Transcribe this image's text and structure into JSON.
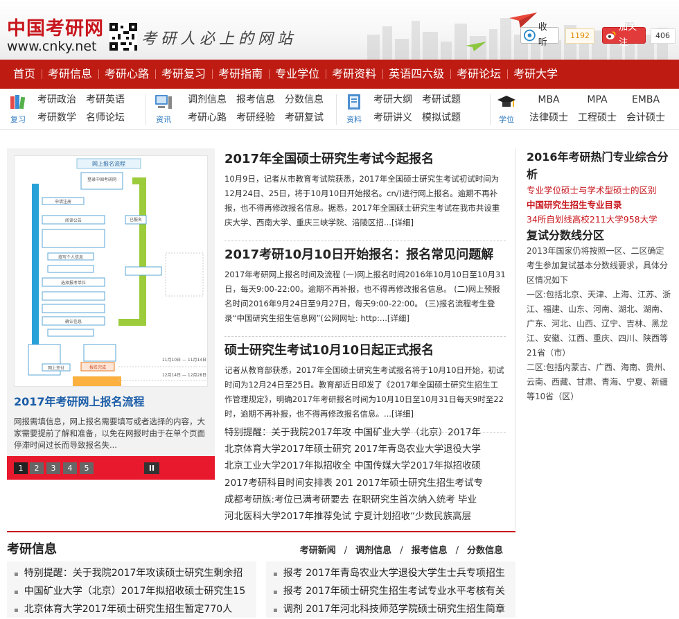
{
  "header": {
    "logo_cn": "中国考研网",
    "logo_en": "www.cnky.net",
    "slogan": "考研人必上的网站",
    "tqq": {
      "label": "收听",
      "count": "1192"
    },
    "weibo": {
      "label": "加关注",
      "count": "406"
    }
  },
  "nav": [
    "首页",
    "考研信息",
    "考研心路",
    "考研复习",
    "考研指南",
    "专业学位",
    "考研资料",
    "英语四六级",
    "考研论坛",
    "考研大学"
  ],
  "subnav": [
    {
      "icon": "books-icon",
      "label": "复习",
      "links": [
        "考研政治",
        "考研英语",
        "考研数学",
        "名师论坛"
      ]
    },
    {
      "icon": "computer-icon",
      "label": "资讯",
      "links": [
        "调剂信息",
        "报考信息",
        "分数信息",
        "考研心路",
        "考研经验",
        "考研复试"
      ]
    },
    {
      "icon": "notebook-icon",
      "label": "资料",
      "links": [
        "考研大纲",
        "考研试题",
        "考研讲义",
        "模拟试题"
      ]
    },
    {
      "icon": "graduation-cap-icon",
      "label": "学位",
      "links": [
        "MBA",
        "MPA",
        "EMBA",
        "法律硕士",
        "工程硕士",
        "会计硕士"
      ]
    }
  ],
  "slider": {
    "title": "2017年考研网上报名流程",
    "desc": "网报需填信息，网上报名需要填写或者选择的内容，大家需要提前了解和准备，以免在网报时由于在单个页面停滞时间过长而导致报名失...",
    "pages": [
      "1",
      "2",
      "3",
      "4",
      "5"
    ],
    "pause": "II",
    "image": {
      "title": "网上报名流程",
      "steps": [
        "登录中国考研网",
        "申请注册",
        "阅读公告",
        "填写个人信息",
        "选择报考单位",
        "确认信息",
        "报名完成",
        "网上支付"
      ],
      "side_note": "已报名",
      "dates": [
        "11月10日 — 11月14日",
        "12月14日 — 12月28日"
      ]
    }
  },
  "articles": [
    {
      "title": "2017年全国硕士研究生考试今起报名",
      "body": "10月9日，记者从市教育考试院获悉，2017年全国硕士研究生考试初试时间为12月24日、25日，将于10月10日开始报名。cn/)进行网上报名。逾期不再补报，也不得再修改报名信息。据悉，2017年全国硕士研究生考试在我市共设重庆大学、西南大学、重庆三峡学院、涪陵区招...[详细]"
    },
    {
      "title": "2017考研10月10日开始报名：报名常见问题解",
      "body": "2017年考研网上报名时间及流程 (一)网上报名时间2016年10月10日至10月31日，每天9:00-22:00。逾期不再补报，也不得再修改报名信息。 (二)网上预报名时间2016年9月24日至9月27日，每天9:00-22:00。 (三)报名流程考生登录“中国研究生招生信息网”(公网网址: http:...[详细]"
    },
    {
      "title": "硕士研究生考试10月10日起正式报名",
      "body": "记者从教育部获悉，2017年全国硕士研究生考试报名将于10月10日开始，初试时间为12月24日至25日。教育部近日印发了《2017年全国硕士研究生招生工作管理规定》，明确2017年考研报名时间为10月10日至10月31日每天9时至22时，逾期不再补报，也不得再修改报名信息。...[详细]"
    }
  ],
  "ticker_lines": [
    [
      "特别提醒：关于我院2017年攻",
      "中国矿业大学（北京）2017年"
    ],
    [
      "北京体育大学2017年硕士研究",
      "2017年青岛农业大学退役大学"
    ],
    [
      "北京工业大学2017年拟招收全",
      "中国传媒大学2017年拟招收硕"
    ],
    [
      "2017考研科目时间安排表",
      "201",
      "2017年硕士研究生招生考试专"
    ],
    [
      "成都考研族:考位已满考研要去",
      "在职研究生首次纳入统考",
      "毕业"
    ],
    [
      "河北医科大学2017年推荐免试",
      "宁夏计划招收“少数民族高层"
    ]
  ],
  "right": {
    "title1": "2016年考研热门专业综合分析",
    "links": [
      "专业学位硕士与学术型硕士的区别",
      "中国研究生招生专业目录",
      "34所自划线高校211大学958大学"
    ],
    "title2": "复试分数线分区",
    "p1": "2013年国家仍将按照一区、二区确定考生参加复试基本分数线要求，具体分区情况如下",
    "p2": "一区:包括北京、天津、上海、江苏、浙江、福建、山东、河南、湖北、湖南、广东、河北、山西、辽宁、吉林、黑龙江、安徽、江西、重庆、四川、陕西等21省（市）",
    "p3": "二区:包括内蒙古、广西、海南、贵州、云南、西藏、甘肃、青海、宁夏、新疆等10省（区）"
  },
  "info": {
    "title": "考研信息",
    "tabs": [
      "考研新闻",
      "调剂信息",
      "报考信息",
      "分数信息"
    ],
    "left": [
      "特别提醒：关于我院2017年攻读硕士研究生剩余招",
      "中国矿业大学（北京）2017年拟招收硕士研究生15",
      "北京体育大学2017年硕士研究生招生暂定770人"
    ],
    "right": [
      "报考  2017年青岛农业大学退役大学生士兵专项招生",
      "报考  2017年硕士研究生招生考试专业水平考核有关",
      "调剂  2017年河北科技师范学院硕士研究生招生简章"
    ]
  },
  "colors": {
    "brand_red": "#be1c13",
    "link_blue": "#1a5ca7",
    "accent_red": "#c8161d"
  }
}
